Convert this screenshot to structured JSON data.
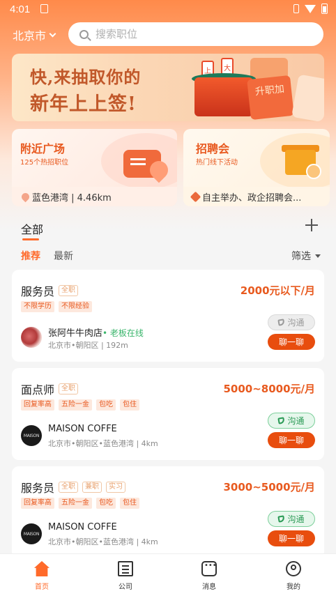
{
  "status_bar": {
    "time": "4:01"
  },
  "header": {
    "city": "北京市",
    "search_placeholder": "搜索职位"
  },
  "banner": {
    "line1": "快,来抽取你的",
    "line2": "新年上上签!",
    "stick1": "上吉",
    "stick2": "大吉",
    "card_text": "升职加"
  },
  "tiles": [
    {
      "title": "附近广场",
      "subtitle": "125个热招职位",
      "footer": "蓝色港湾 | 4.46km"
    },
    {
      "title": "招聘会",
      "subtitle": "热门线下活动",
      "footer": "自主举办、政企招聘会..."
    }
  ],
  "section": {
    "title": "全部",
    "tab_recommend": "推荐",
    "tab_latest": "最新",
    "filter": "筛选"
  },
  "jobs": [
    {
      "title": "服务员",
      "chips": [
        "全职"
      ],
      "salary": "2000元以下/月",
      "tags": [
        "不限学历",
        "不限经验"
      ],
      "shop": "张阿牛牛肉店",
      "online": "• 老板在线",
      "address": "北京市•朝阳区 | 192m",
      "comm": "沟通",
      "chat": "聊一聊"
    },
    {
      "title": "面点师",
      "chips": [
        "全职"
      ],
      "salary": "5000~8000元/月",
      "tags": [
        "回复率高",
        "五险一金",
        "包吃",
        "包住"
      ],
      "shop": "MAISON COFFE",
      "online": "",
      "address": "北京市•朝阳区•蓝色港湾 | 4km",
      "avatar_text": "MAISON",
      "comm": "沟通",
      "chat": "聊一聊"
    },
    {
      "title": "服务员",
      "chips": [
        "全职",
        "兼职",
        "实习"
      ],
      "salary": "3000~5000元/月",
      "tags": [
        "回复率高",
        "五险一金",
        "包吃",
        "包住"
      ],
      "shop": "MAISON COFFE",
      "online": "",
      "address": "北京市•朝阳区•蓝色港湾 | 4km",
      "avatar_text": "MAISON",
      "comm": "沟通",
      "chat": "聊一聊"
    }
  ],
  "nav": [
    {
      "label": "首页",
      "icon": "home-icon"
    },
    {
      "label": "公司",
      "icon": "company-icon"
    },
    {
      "label": "消息",
      "icon": "message-icon"
    },
    {
      "label": "我的",
      "icon": "profile-icon"
    }
  ],
  "colors": {
    "accent": "#ff6a2a",
    "chat_button": "#e84d0e",
    "online": "#3ab56b"
  }
}
